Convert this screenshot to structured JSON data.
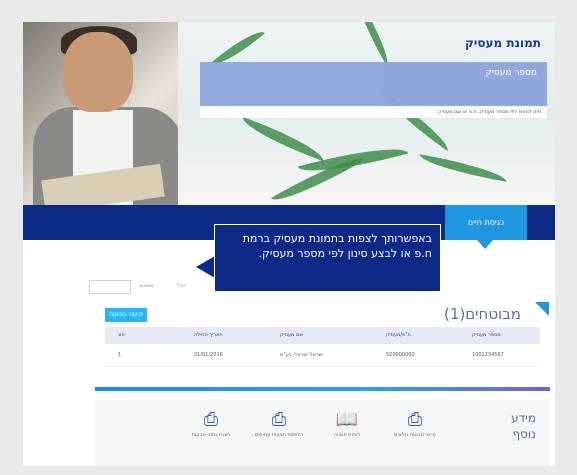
{
  "hero": {
    "title": "תמונת מעסיק",
    "search_placeholder": "מספר מעסיק",
    "note": "ניתן לחפש לפי מספר מעסיק, ח.פ או שם מעסיק"
  },
  "nav": {
    "active_tab": "כניסת חיים"
  },
  "tooltip": {
    "text": "באפשרותך לצפות בתמונת מעסיק ברמת ח.פ או לבצע סינון לפי מספר מעסיק."
  },
  "filters": {
    "label1": "סטטוס",
    "label2": "הכל"
  },
  "section": {
    "title": "מבוטחים(1)",
    "add_button": "קישור מבוטח"
  },
  "table": {
    "headers": [
      "מספר מעסיק",
      "ח\"פ/מעסיק",
      "שם מעסיק",
      "תאריך תחילה",
      "סוג"
    ],
    "rows": [
      [
        "1001234567",
        "520000000",
        "ישראל ישראלי בע\"מ",
        "01/01/2016",
        "1"
      ]
    ]
  },
  "actions": {
    "title": "מידע נוסף",
    "items": [
      {
        "icon": "printer-icon",
        "label": "פרטי מבוטח מלאים"
      },
      {
        "icon": "document-icon",
        "label": "דוחות פנסיה"
      },
      {
        "icon": "printer-icon",
        "label": "הדפסת תמצית עמיתים"
      },
      {
        "icon": "printer-icon",
        "label": "הצגת נתוני מבוטח"
      }
    ]
  },
  "colors": {
    "primary": "#0c2a86",
    "accent": "#2196e0",
    "link": "#29b6f6"
  }
}
